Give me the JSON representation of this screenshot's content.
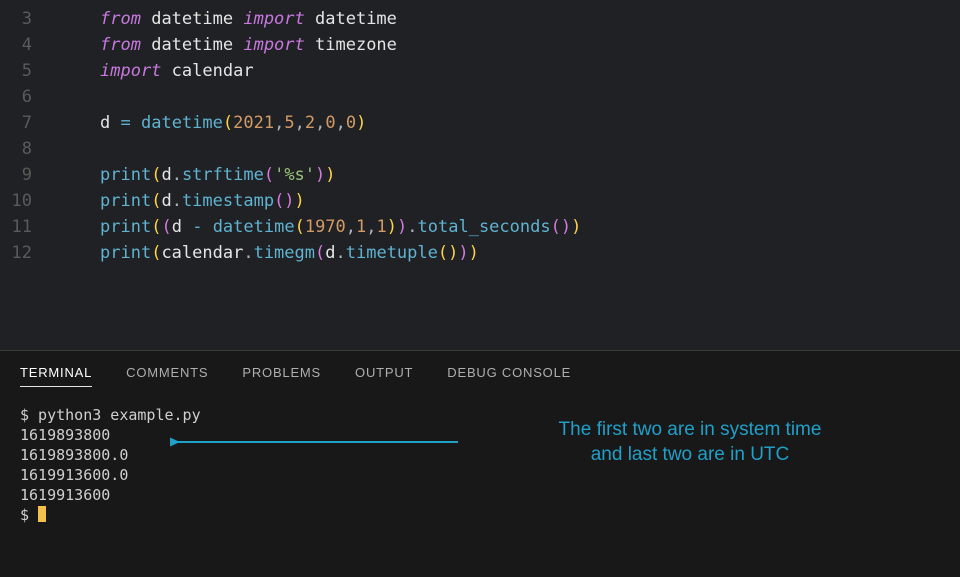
{
  "editor": {
    "lines": [
      {
        "n": 3,
        "html": "<span class='kw-import'>from</span> <span class='mod'>datetime</span> <span class='kw-import'>import</span> <span class='ident'>datetime</span>"
      },
      {
        "n": 4,
        "html": "<span class='kw-import'>from</span> <span class='mod'>datetime</span> <span class='kw-import'>import</span> <span class='ident'>timezone</span>"
      },
      {
        "n": 5,
        "html": "<span class='kw-import'>import</span> <span class='mod'>calendar</span>"
      },
      {
        "n": 6,
        "html": ""
      },
      {
        "n": 7,
        "html": "<span class='ident'>d</span> <span class='op'>=</span> <span class='call'>datetime</span><span class='paren'>(</span><span class='num'>2021</span><span class='punct'>,</span><span class='num'>5</span><span class='punct'>,</span><span class='num'>2</span><span class='punct'>,</span><span class='num'>0</span><span class='punct'>,</span><span class='num'>0</span><span class='paren'>)</span>"
      },
      {
        "n": 8,
        "html": ""
      },
      {
        "n": 9,
        "html": "<span class='call'>print</span><span class='paren'>(</span><span class='ident'>d</span><span class='punct'>.</span><span class='call'>strftime</span><span class='paren2'>(</span><span class='str'>'%s'</span><span class='paren2'>)</span><span class='paren'>)</span>"
      },
      {
        "n": 10,
        "html": "<span class='call'>print</span><span class='paren'>(</span><span class='ident'>d</span><span class='punct'>.</span><span class='call'>timestamp</span><span class='paren2'>()</span><span class='paren'>)</span>"
      },
      {
        "n": 11,
        "html": "<span class='call'>print</span><span class='paren'>(</span><span class='paren2'>(</span><span class='ident'>d</span> <span class='op'>-</span> <span class='call'>datetime</span><span class='paren'>(</span><span class='num'>1970</span><span class='punct'>,</span><span class='num'>1</span><span class='punct'>,</span><span class='num'>1</span><span class='paren'>)</span><span class='paren2'>)</span><span class='punct'>.</span><span class='call'>total_seconds</span><span class='paren2'>()</span><span class='paren'>)</span>"
      },
      {
        "n": 12,
        "html": "<span class='call'>print</span><span class='paren'>(</span><span class='ident'>calendar</span><span class='punct'>.</span><span class='call'>timegm</span><span class='paren2'>(</span><span class='ident'>d</span><span class='punct'>.</span><span class='call'>timetuple</span><span class='paren'>()</span><span class='paren2'>)</span><span class='paren'>)</span>"
      }
    ]
  },
  "panel": {
    "tabs": [
      "TERMINAL",
      "COMMENTS",
      "PROBLEMS",
      "OUTPUT",
      "DEBUG CONSOLE"
    ],
    "active_tab": 0,
    "terminal_lines": [
      "$ python3 example.py",
      "1619893800",
      "1619893800.0",
      "1619913600.0",
      "1619913600"
    ],
    "prompt": "$ ",
    "annotation_line1": "The first two are in system time",
    "annotation_line2": "and last two are in UTC"
  },
  "colors": {
    "annotation": "#1fa0c9",
    "cursor": "#f3c04b"
  }
}
